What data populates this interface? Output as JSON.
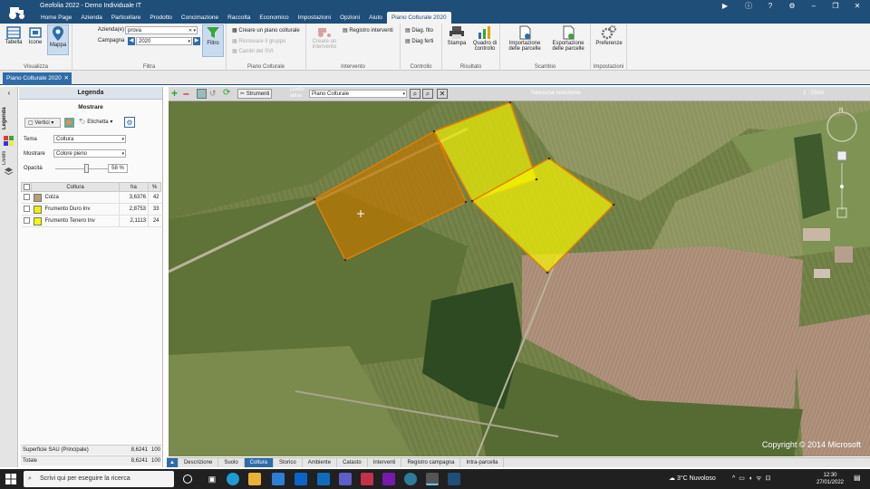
{
  "app": {
    "title": "Geofolia 2022 - Demo Individuale IT",
    "menu": [
      "Home Page",
      "Azienda",
      "Particellare",
      "Prodotto",
      "Concimazione",
      "Raccolta",
      "Economico",
      "Impostazioni",
      "Opzioni",
      "Aiuto",
      "Piano Colturale 2020"
    ],
    "active_menu_index": 10
  },
  "ribbon": {
    "visualizza": {
      "label": "Visualizza",
      "buttons": [
        "Tabella",
        "Icone",
        "Mappa"
      ]
    },
    "filtra": {
      "label": "Filtra",
      "azienda_label": "Azienda(e)",
      "azienda_value": "prova",
      "campagna_label": "Campagna",
      "campagna_value": "2020",
      "filtro": "Filtro"
    },
    "piano": {
      "label": "Piano Colturale",
      "items": [
        "Creare un piano colturale",
        "Rinnovare il gruppo",
        "Cambi del SVI"
      ]
    },
    "intervento": {
      "label": "Intervento",
      "crea": "Creare un intervento",
      "registro": "Registro interventi"
    },
    "controllo": {
      "label": "Controllo",
      "items": [
        "Diag. fito",
        "Diag ferti"
      ]
    },
    "risultato": {
      "label": "Risultato",
      "stampa": "Stampa",
      "quadro": "Quadro di controllo"
    },
    "scambio": {
      "label": "Scambio",
      "importazione": "Importazione delle parcelle",
      "esportazione": "Esportazione delle parcelle"
    },
    "impostazioni": {
      "label": "Impostazioni",
      "preferenze": "Preferenze"
    }
  },
  "doc_tab": "Piano Colturale 2020",
  "sidetabs": [
    "Legenda",
    "Livelli"
  ],
  "legend": {
    "header": "Legenda",
    "subheader": "Mostrare",
    "vertici": "Vertici",
    "etichetta": "Etichetta",
    "tema_label": "Tema",
    "tema_value": "Coltura",
    "mostrare_label": "Mostrare",
    "mostrare_value": "Colore pieno",
    "opacita_label": "Opacità",
    "opacita_value": "58 %",
    "opacita": 0.58,
    "columns": [
      "Coltura",
      "ha",
      "%"
    ],
    "rows": [
      {
        "name": "Colza",
        "ha": "3,6376",
        "pct": "42",
        "color": "#b8a070"
      },
      {
        "name": "Frumento Duro Inv",
        "ha": "2,8753",
        "pct": "33",
        "color": "#f2f000"
      },
      {
        "name": "Frumento Tenero Inv",
        "ha": "2,1113",
        "pct": "24",
        "color": "#f8f800"
      }
    ],
    "sau_label": "Superficie SAU (Principale)",
    "sau_ha": "8,6241",
    "sau_pct": "100",
    "totale_label": "Totale",
    "totale_ha": "8,6241",
    "totale_pct": "100"
  },
  "map_toolbar": {
    "strumenti": "Strumenti",
    "livello_label": "Livello attivo",
    "livello_value": "Piano Colturale",
    "selection": "Nessuna selezione",
    "scale": "1 : 5565"
  },
  "map": {
    "copyright": "Copyright © 2014 Microsoft"
  },
  "bottom_tabs": [
    "Descrizione",
    "Suolo",
    "Coltura",
    "Storico",
    "Ambiente",
    "Catasto",
    "Interventi",
    "Registro campagna",
    "Intra-parcella"
  ],
  "active_bottom_tab": 2,
  "taskbar": {
    "search": "Scrivi qui per eseguire la ricerca",
    "weather": "3°C  Nuvoloso",
    "time": "12:30",
    "date": "27/01/2022"
  }
}
